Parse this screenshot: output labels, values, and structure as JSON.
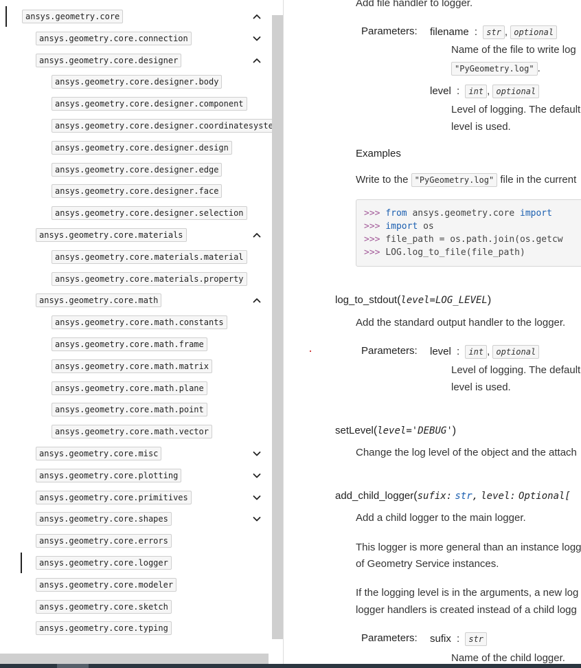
{
  "sidebar": {
    "items": [
      {
        "label": "ansys.geometry.core",
        "indent": "top",
        "chevron": "up",
        "active": true
      },
      {
        "label": "ansys.geometry.core.connection",
        "indent": "l1",
        "chevron": "down"
      },
      {
        "label": "ansys.geometry.core.designer",
        "indent": "l1",
        "chevron": "up"
      },
      {
        "label": "ansys.geometry.core.designer.body",
        "indent": "l2"
      },
      {
        "label": "ansys.geometry.core.designer.component",
        "indent": "l2"
      },
      {
        "label": "ansys.geometry.core.designer.coordinatesystem",
        "indent": "l2"
      },
      {
        "label": "ansys.geometry.core.designer.design",
        "indent": "l2"
      },
      {
        "label": "ansys.geometry.core.designer.edge",
        "indent": "l2"
      },
      {
        "label": "ansys.geometry.core.designer.face",
        "indent": "l2"
      },
      {
        "label": "ansys.geometry.core.designer.selection",
        "indent": "l2"
      },
      {
        "label": "ansys.geometry.core.materials",
        "indent": "l1",
        "chevron": "up"
      },
      {
        "label": "ansys.geometry.core.materials.material",
        "indent": "l2"
      },
      {
        "label": "ansys.geometry.core.materials.property",
        "indent": "l2"
      },
      {
        "label": "ansys.geometry.core.math",
        "indent": "l1",
        "chevron": "up"
      },
      {
        "label": "ansys.geometry.core.math.constants",
        "indent": "l2"
      },
      {
        "label": "ansys.geometry.core.math.frame",
        "indent": "l2"
      },
      {
        "label": "ansys.geometry.core.math.matrix",
        "indent": "l2"
      },
      {
        "label": "ansys.geometry.core.math.plane",
        "indent": "l2"
      },
      {
        "label": "ansys.geometry.core.math.point",
        "indent": "l2"
      },
      {
        "label": "ansys.geometry.core.math.vector",
        "indent": "l2"
      },
      {
        "label": "ansys.geometry.core.misc",
        "indent": "l1",
        "chevron": "down"
      },
      {
        "label": "ansys.geometry.core.plotting",
        "indent": "l1",
        "chevron": "down"
      },
      {
        "label": "ansys.geometry.core.primitives",
        "indent": "l1",
        "chevron": "down"
      },
      {
        "label": "ansys.geometry.core.shapes",
        "indent": "l1",
        "chevron": "down"
      },
      {
        "label": "ansys.geometry.core.errors",
        "indent": "l1"
      },
      {
        "label": "ansys.geometry.core.logger",
        "indent": "l1",
        "active": true
      },
      {
        "label": "ansys.geometry.core.modeler",
        "indent": "l1"
      },
      {
        "label": "ansys.geometry.core.sketch",
        "indent": "l1"
      },
      {
        "label": "ansys.geometry.core.typing",
        "indent": "l1"
      }
    ]
  },
  "content": {
    "top_desc": "Add file handler to logger.",
    "params_label": "Parameters:",
    "p_filename": {
      "name": "filename",
      "colon": ":",
      "type": "str",
      "sep": ",",
      "opt": "optional",
      "desc1": "Name of the file to write log",
      "desc2": "\"PyGeometry.log\"",
      "desc2_tail": "."
    },
    "p_level": {
      "name": "level",
      "colon": ":",
      "type": "int",
      "sep": ",",
      "opt": "optional",
      "desc1": "Level of logging. The default",
      "desc2": "level is used."
    },
    "examples_heading": "Examples",
    "examples_text_pre": "Write to the",
    "examples_text_code": "\"PyGeometry.log\"",
    "examples_text_post": "file in the current",
    "code": [
      {
        "prompt": ">>>",
        "kw1": "from",
        "mid": "ansys.geometry.core",
        "kw2": "import",
        "rest": ""
      },
      {
        "prompt": ">>>",
        "kw1": "import",
        "mid": "os",
        "kw2": "",
        "rest": ""
      },
      {
        "prompt": ">>>",
        "kw1": "",
        "mid": "file_path = os.path.join(os.getcw",
        "kw2": "",
        "rest": ""
      },
      {
        "prompt": ">>>",
        "kw1": "",
        "mid": "LOG.log_to_file(file_path)",
        "kw2": "",
        "rest": ""
      }
    ],
    "stdout": {
      "name": "log_to_stdout",
      "open": "(",
      "arg": "level=LOG_LEVEL",
      "close": ")",
      "desc": "Add the standard output handler to the logger.",
      "p_name": "level",
      "p_colon": ":",
      "p_type": "int",
      "p_sep": ",",
      "p_opt": "optional",
      "p_desc1": "Level of logging. The default",
      "p_desc2": "level is used."
    },
    "setlevel": {
      "name": "setLevel",
      "open": "(",
      "arg": "level='DEBUG'",
      "close": ")",
      "desc": "Change the log level of the object and the attach"
    },
    "child": {
      "name": "add_child_logger",
      "open": "(",
      "arg1": "sufix:",
      "type1": "str",
      "sep": ",",
      "arg2": "level:",
      "type2": "Optional[",
      "desc": "Add a child logger to the main logger.",
      "para1a": "This logger is more general than an instance logg",
      "para1b": "of Geometry Service instances.",
      "para2a": "If the logging level is in the arguments, a new log",
      "para2b": "logger handlers is created instead of a child logg",
      "p_name": "sufix",
      "p_colon": ":",
      "p_type": "str",
      "p_desc": "Name of the child logger."
    }
  },
  "colors": {
    "link_blue": "#1b5fb0",
    "prompt": "#a45c9a",
    "code_bg": "#f5f5f5",
    "bottom_bar": "#2b3640"
  }
}
